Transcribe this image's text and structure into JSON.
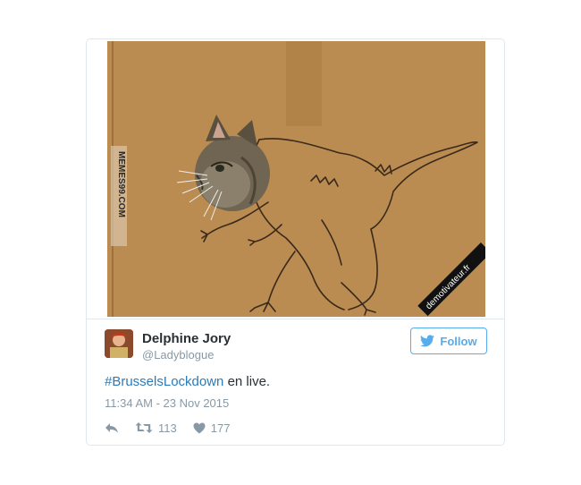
{
  "media": {
    "watermark_left": "MEMES99.COM",
    "watermark_right": "demotivateur.fr"
  },
  "user": {
    "name": "Delphine Jory",
    "handle": "@Ladyblogue"
  },
  "follow_button": {
    "icon": "twitter-bird-icon",
    "label": "Follow"
  },
  "tweet": {
    "hashtag": "#BrusselsLockdown",
    "text": " en live.",
    "timestamp": "11:34 AM - 23 Nov 2015"
  },
  "actions": {
    "reply_icon": "reply-icon",
    "retweet_icon": "retweet-icon",
    "retweet_count": "113",
    "like_icon": "heart-icon",
    "like_count": "177"
  },
  "colors": {
    "accent": "#55acee",
    "link": "#2b7bb9",
    "muted": "#8899a6",
    "cardboard": "#b7874d"
  }
}
